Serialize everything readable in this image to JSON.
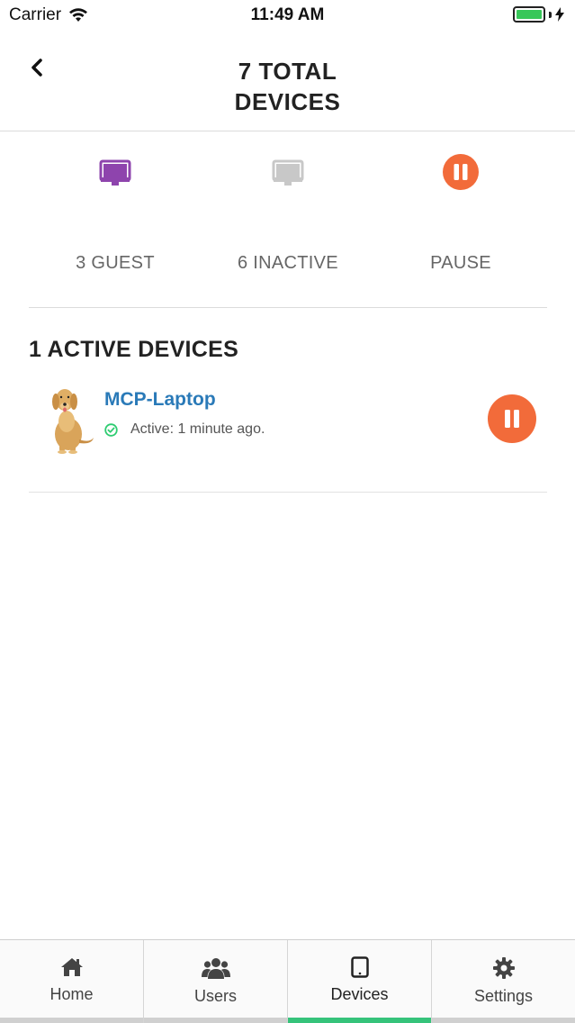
{
  "status_bar": {
    "carrier": "Carrier",
    "time": "11:49 AM"
  },
  "header": {
    "title_line1": "7 TOTAL",
    "title_line2": "DEVICES"
  },
  "summary": [
    {
      "label": "3 GUEST",
      "icon": "monitor-icon",
      "color": "#8e44ad"
    },
    {
      "label": "6 INACTIVE",
      "icon": "monitor-icon",
      "color": "#c8c8c8"
    },
    {
      "label": "PAUSE",
      "icon": "pause-icon",
      "color": "#f26b3a"
    }
  ],
  "active_section": {
    "heading": "1 ACTIVE DEVICES",
    "devices": [
      {
        "name": "MCP-Laptop",
        "status": "Active: 1 minute ago.",
        "avatar": "dog-avatar"
      }
    ]
  },
  "tabs": [
    {
      "label": "Home",
      "icon": "home-icon",
      "active": false
    },
    {
      "label": "Users",
      "icon": "users-icon",
      "active": false
    },
    {
      "label": "Devices",
      "icon": "tablet-icon",
      "active": true
    },
    {
      "label": "Settings",
      "icon": "gear-icon",
      "active": false
    }
  ],
  "colors": {
    "accent_orange": "#f26b3a",
    "guest_purple": "#8e44ad",
    "link_blue": "#2a7ab8",
    "active_green": "#35c37a"
  }
}
